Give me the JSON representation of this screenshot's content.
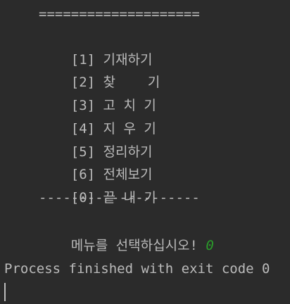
{
  "console": {
    "separator_top": "====================",
    "menu": [
      {
        "key": "[1]",
        "label": "기재하기"
      },
      {
        "key": "[2]",
        "label": "찾    기"
      },
      {
        "key": "[3]",
        "label": "고 치 기"
      },
      {
        "key": "[4]",
        "label": "지 우 기"
      },
      {
        "key": "[5]",
        "label": "정리하기"
      },
      {
        "key": "[6]",
        "label": "전체보기"
      },
      {
        "key": "[0]",
        "label": "끝 내 기"
      }
    ],
    "separator_bottom": "--------------------",
    "prompt": "메뉴를 선택하십시오! ",
    "input_value": "0",
    "process_message": "Process finished with exit code 0"
  }
}
